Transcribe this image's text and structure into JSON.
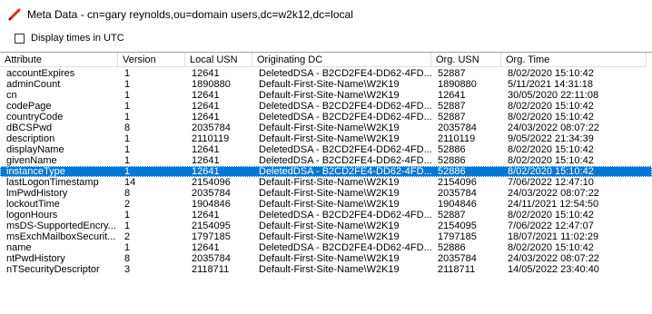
{
  "window": {
    "title": "Meta Data - cn=gary reynolds,ou=domain users,dc=w2k12,dc=local",
    "icon": "pencil-icon",
    "icon_color": "#d92a2a"
  },
  "options": {
    "display_utc_label": "Display times in UTC",
    "display_utc_checked": false
  },
  "table": {
    "columns": [
      "Attribute",
      "Version",
      "Local USN",
      "Originating DC",
      "Org. USN",
      "Org. Time"
    ],
    "selected_row": 9,
    "selection_color": "#0078d7",
    "rows": [
      [
        "accountExpires",
        "1",
        "12641",
        "DeletedDSA - B2CD2FE4-DD62-4FD...",
        "52887",
        "8/02/2020 15:10:42"
      ],
      [
        "adminCount",
        "1",
        "1890880",
        "Default-First-Site-Name\\W2K19",
        "1890880",
        "5/11/2021 14:31:18"
      ],
      [
        "cn",
        "1",
        "12641",
        "Default-First-Site-Name\\W2K19",
        "12641",
        "30/05/2020 22:11:08"
      ],
      [
        "codePage",
        "1",
        "12641",
        "DeletedDSA - B2CD2FE4-DD62-4FD...",
        "52887",
        "8/02/2020 15:10:42"
      ],
      [
        "countryCode",
        "1",
        "12641",
        "DeletedDSA - B2CD2FE4-DD62-4FD...",
        "52887",
        "8/02/2020 15:10:42"
      ],
      [
        "dBCSPwd",
        "8",
        "2035784",
        "Default-First-Site-Name\\W2K19",
        "2035784",
        "24/03/2022 08:07:22"
      ],
      [
        "description",
        "1",
        "2110119",
        "Default-First-Site-Name\\W2K19",
        "2110119",
        "9/05/2022 21:34:39"
      ],
      [
        "displayName",
        "1",
        "12641",
        "DeletedDSA - B2CD2FE4-DD62-4FD...",
        "52886",
        "8/02/2020 15:10:42"
      ],
      [
        "givenName",
        "1",
        "12641",
        "DeletedDSA - B2CD2FE4-DD62-4FD...",
        "52886",
        "8/02/2020 15:10:42"
      ],
      [
        "instanceType",
        "1",
        "12641",
        "DeletedDSA - B2CD2FE4-DD62-4FD...",
        "52886",
        "8/02/2020 15:10:42"
      ],
      [
        "lastLogonTimestamp",
        "14",
        "2154096",
        "Default-First-Site-Name\\W2K19",
        "2154096",
        "7/06/2022 12:47:10"
      ],
      [
        "lmPwdHistory",
        "8",
        "2035784",
        "Default-First-Site-Name\\W2K19",
        "2035784",
        "24/03/2022 08:07:22"
      ],
      [
        "lockoutTime",
        "2",
        "1904846",
        "Default-First-Site-Name\\W2K19",
        "1904846",
        "24/11/2021 12:54:50"
      ],
      [
        "logonHours",
        "1",
        "12641",
        "DeletedDSA - B2CD2FE4-DD62-4FD...",
        "52887",
        "8/02/2020 15:10:42"
      ],
      [
        "msDS-SupportedEncry...",
        "1",
        "2154095",
        "Default-First-Site-Name\\W2K19",
        "2154095",
        "7/06/2022 12:47:07"
      ],
      [
        "msExchMailboxSecurit...",
        "2",
        "1797185",
        "Default-First-Site-Name\\W2K19",
        "1797185",
        "18/07/2021 11:02:29"
      ],
      [
        "name",
        "1",
        "12641",
        "DeletedDSA - B2CD2FE4-DD62-4FD...",
        "52886",
        "8/02/2020 15:10:42"
      ],
      [
        "ntPwdHistory",
        "8",
        "2035784",
        "Default-First-Site-Name\\W2K19",
        "2035784",
        "24/03/2022 08:07:22"
      ],
      [
        "nTSecurityDescriptor",
        "3",
        "2118711",
        "Default-First-Site-Name\\W2K19",
        "2118711",
        "14/05/2022 23:40:40"
      ]
    ]
  }
}
